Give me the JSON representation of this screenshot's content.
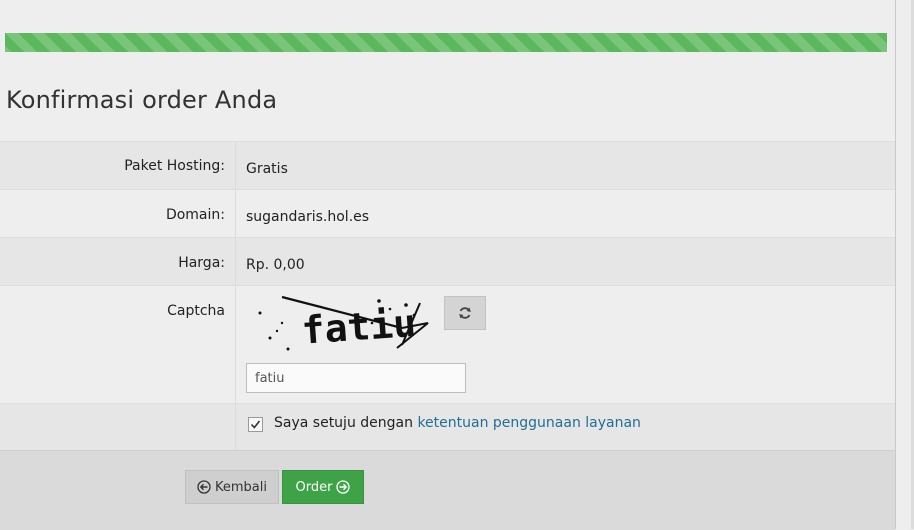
{
  "page": {
    "title": "Konfirmasi order Anda",
    "progress_percent": 100,
    "accent_color": "#5cb85c"
  },
  "details": [
    {
      "label": "Paket Hosting:",
      "value": "Gratis"
    },
    {
      "label": "Domain:",
      "value": "sugandaris.hol.es"
    },
    {
      "label": "Harga:",
      "value": "Rp. 0,00"
    }
  ],
  "captcha": {
    "label": "Captcha",
    "image_text": "fatiu",
    "input_value": "fatiu",
    "refresh_icon": "refresh-icon"
  },
  "agreement": {
    "checked": true,
    "text": "Saya setuju dengan",
    "link_text": "ketentuan penggunaan layanan",
    "link_color": "#1f6f96"
  },
  "buttons": {
    "back_label": "Kembali",
    "back_icon": "arrow-left-circle-icon",
    "order_label": "Order",
    "order_icon": "arrow-right-circle-icon"
  }
}
